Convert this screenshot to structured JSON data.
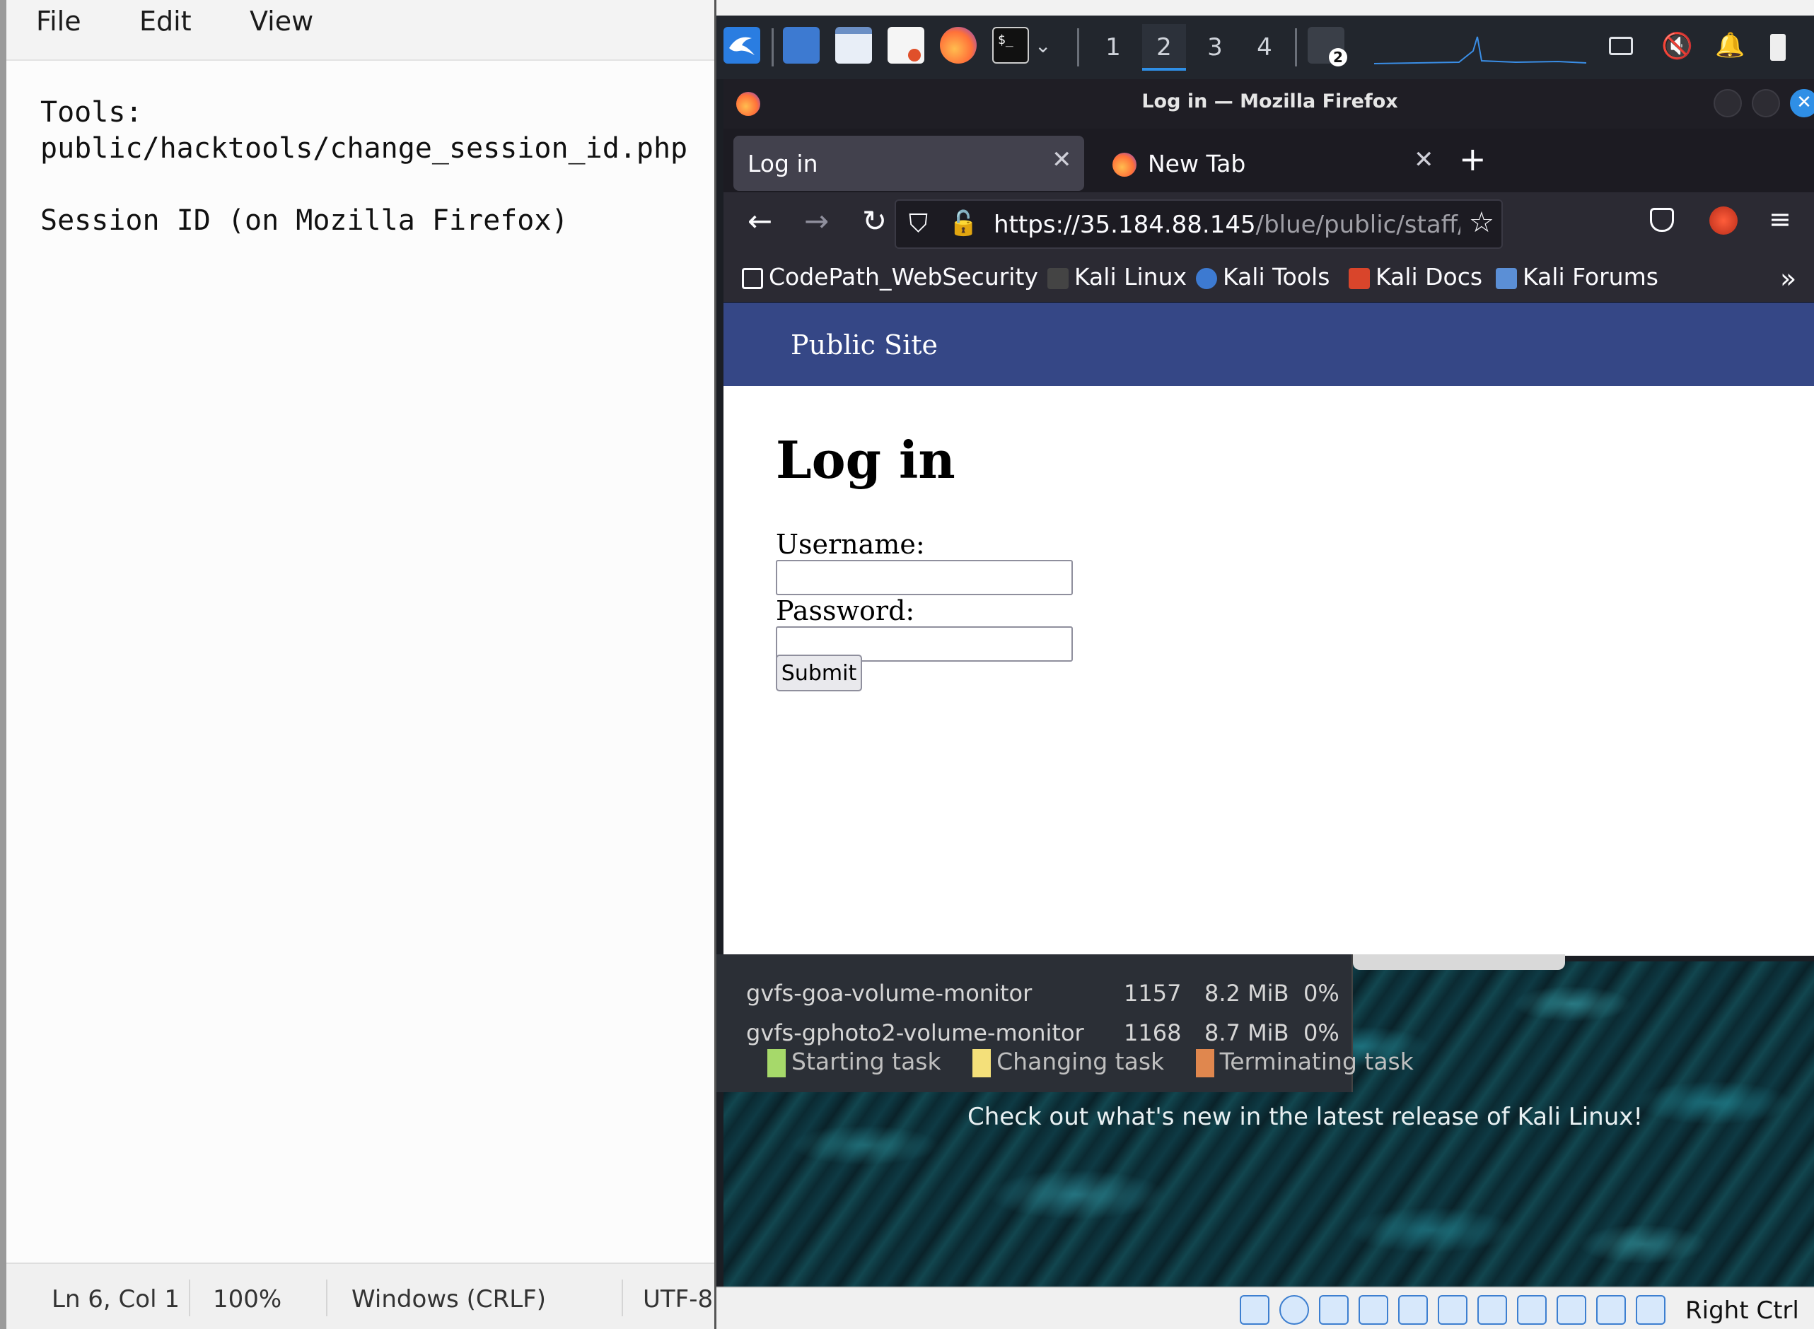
{
  "notepad": {
    "menu": [
      "File",
      "Edit",
      "View"
    ],
    "lines": [
      "Tools:",
      "public/hacktools/change_session_id.php",
      "",
      "Session ID (on Mozilla Firefox)"
    ],
    "status": {
      "position": "Ln 6, Col 1",
      "zoom": "100%",
      "line_ending": "Windows (CRLF)",
      "encoding": "UTF-8"
    }
  },
  "kali_panel": {
    "workspaces": [
      "1",
      "2",
      "3",
      "4"
    ],
    "active_workspace": "2",
    "badge": "2",
    "icons": [
      "kali-menu-icon",
      "desktop-icon",
      "files-icon",
      "text-editor-icon",
      "firefox-icon",
      "terminal-icon",
      "notifications-icon",
      "volume-muted-icon",
      "battery-icon"
    ]
  },
  "firefox": {
    "window_title": "Log in — Mozilla Firefox",
    "tabs": [
      {
        "label": "Log in",
        "active": true
      },
      {
        "label": "New Tab",
        "active": false
      }
    ],
    "url_host": "https://35.184.88.145",
    "url_path": "/blue/public/staff/log",
    "bookmarks": [
      "CodePath_WebSecurity",
      "Kali Linux",
      "Kali Tools",
      "Kali Docs",
      "Kali Forums"
    ],
    "overflow": "»"
  },
  "page": {
    "site_title": "Public Site",
    "heading": "Log in",
    "username_label": "Username:",
    "password_label": "Password:",
    "submit_label": "Submit"
  },
  "system_monitor": {
    "rows": [
      {
        "name": "gvfs-goa-volume-monitor",
        "pid": "1157",
        "memory": "8.2 MiB",
        "cpu": "0%"
      },
      {
        "name": "gvfs-gphoto2-volume-monitor",
        "pid": "1168",
        "memory": "8.7 MiB",
        "cpu": "0%"
      }
    ],
    "legend": [
      {
        "label": "Starting task",
        "color": "#a6d96a"
      },
      {
        "label": "Changing task",
        "color": "#f4e07a"
      },
      {
        "label": "Terminating task",
        "color": "#e0874e"
      }
    ]
  },
  "desktop": {
    "news": "Check out what's new in the latest release of Kali Linux!"
  },
  "vbox": {
    "host_key": "Right Ctrl"
  },
  "colors": {
    "site_header": "#354786",
    "firefox_chrome": "#2b2a33",
    "kali_panel": "#22262d",
    "accent": "#2f8fe6"
  }
}
